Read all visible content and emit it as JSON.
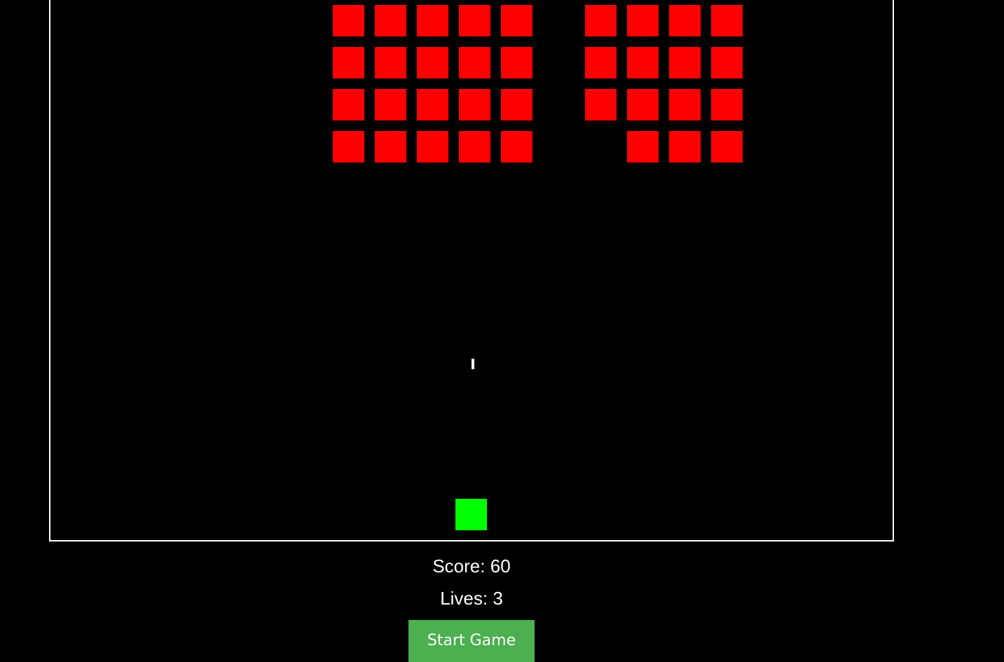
{
  "game": {
    "enemy_color": "#ff0000",
    "player_color": "#00ff00",
    "bullet_color": "#ffffff",
    "border_color": "#ffffff",
    "background": "#000000",
    "enemy_rows": 4,
    "enemy_cols": 10,
    "enemies_destroyed": [
      [
        0,
        5
      ],
      [
        1,
        5
      ],
      [
        2,
        5
      ],
      [
        3,
        5
      ],
      [
        3,
        6
      ]
    ]
  },
  "hud": {
    "score_label": "Score:",
    "score_value": "60",
    "lives_label": "Lives:",
    "lives_value": "3"
  },
  "controls": {
    "start_button_label": "Start Game",
    "start_button_color": "#4caf50"
  }
}
